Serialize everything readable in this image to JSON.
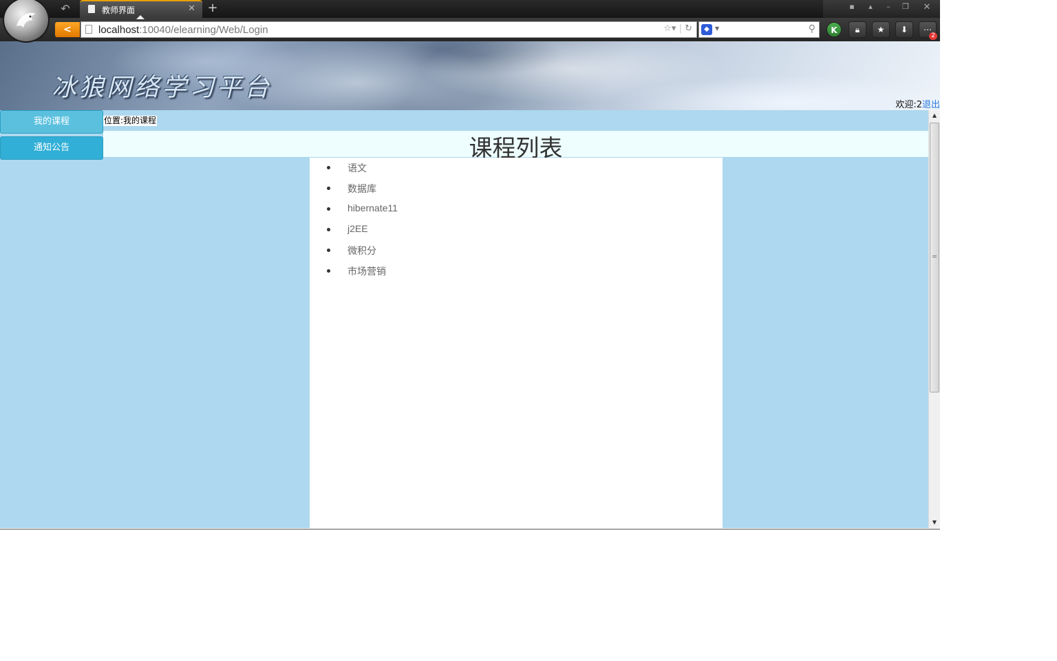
{
  "browser": {
    "tab_title": "教师界面",
    "url_host": "localhost",
    "url_rest": ":10040/elearning/Web/Login",
    "badge_count": "2"
  },
  "page": {
    "welcome_text": "欢迎:2",
    "logout_label": "退出",
    "banner_title": "冰狼网络学习平台",
    "nav": {
      "my_courses": "我的课程",
      "notices": "通知公告"
    },
    "breadcrumb": "位置:我的课程",
    "list_title": "课程列表",
    "courses": [
      "语文",
      "数据库",
      "hibernate11",
      "j2EE",
      "微积分",
      "市场营销"
    ]
  }
}
